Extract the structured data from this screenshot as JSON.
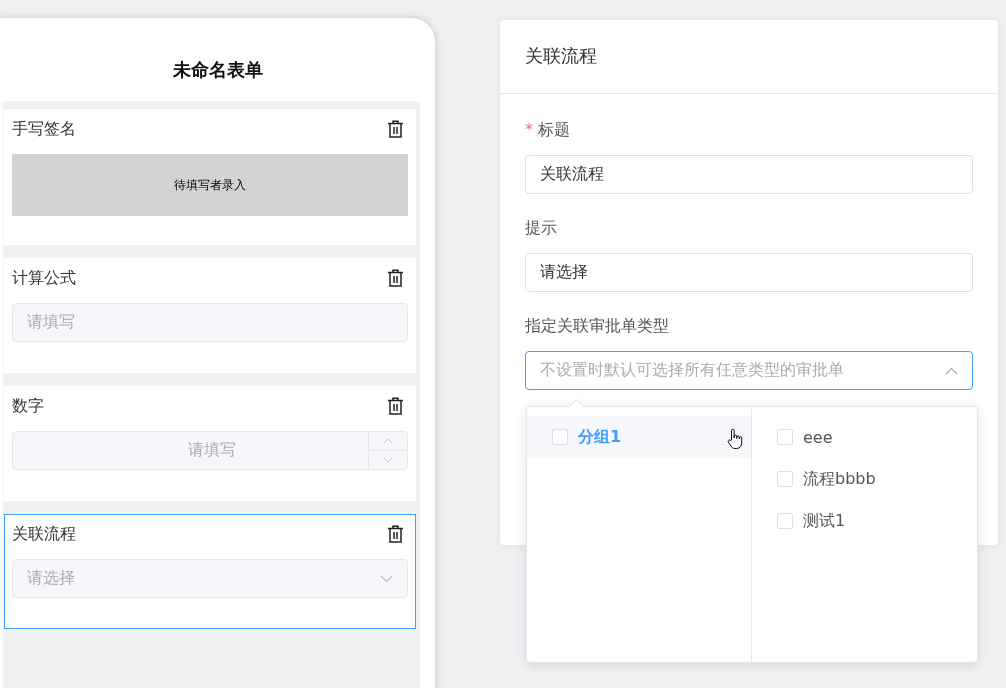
{
  "form": {
    "title": "未命名表单",
    "fields": [
      {
        "kind": "signature",
        "label": "手写签名",
        "text": "待填写者录入",
        "selected": false
      },
      {
        "kind": "input",
        "label": "计算公式",
        "placeholder": "请填写",
        "selected": false
      },
      {
        "kind": "number",
        "label": "数字",
        "placeholder": "请填写",
        "selected": false
      },
      {
        "kind": "select",
        "label": "关联流程",
        "placeholder": "请选择",
        "selected": true
      }
    ]
  },
  "properties": {
    "title": "关联流程",
    "required_mark": "*",
    "fields": [
      {
        "kind": "input",
        "label": "标题",
        "required": true,
        "value": "关联流程"
      },
      {
        "kind": "input",
        "label": "提示",
        "required": false,
        "value": "请选择"
      },
      {
        "kind": "cascader",
        "label": "指定关联审批单类型",
        "required": false,
        "placeholder": "不设置时默认可选择所有任意类型的审批单",
        "expanded": true
      }
    ]
  },
  "cascader": {
    "groups": [
      {
        "label": "分组1",
        "selected": true,
        "checked": false
      }
    ],
    "options": [
      {
        "label": "eee",
        "checked": false
      },
      {
        "label": "流程bbbb",
        "checked": false
      },
      {
        "label": "测试1",
        "checked": false
      }
    ]
  }
}
